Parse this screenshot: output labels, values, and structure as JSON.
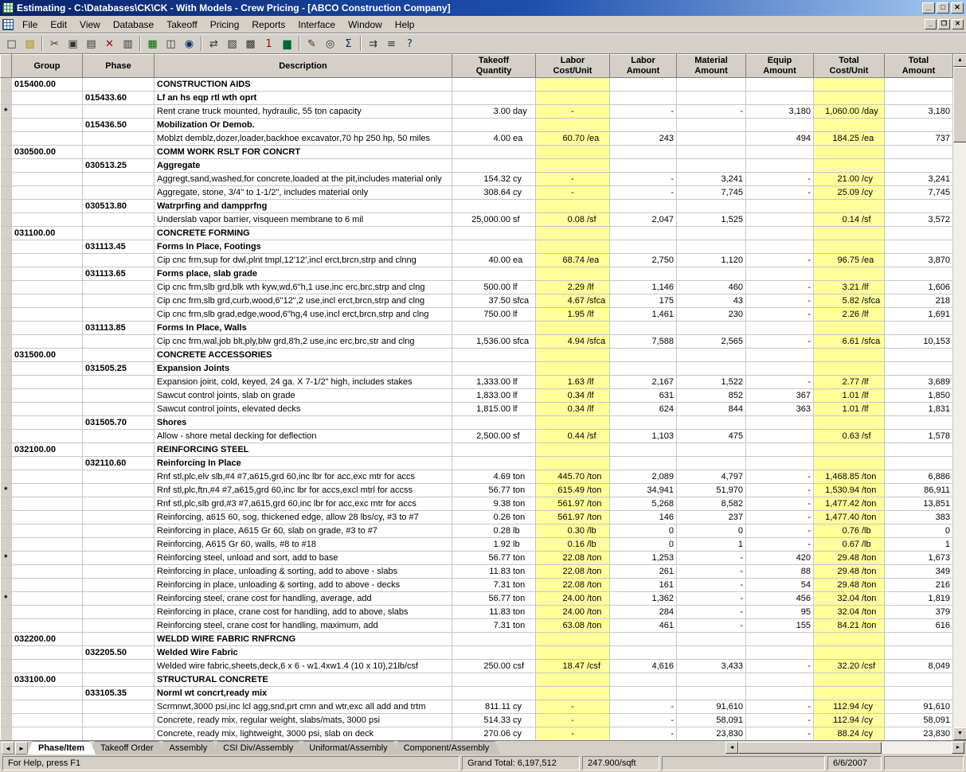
{
  "window": {
    "title": "Estimating - C:\\Databases\\CK\\CK - With Models - Crew Pricing - [ABCO Construction Company]"
  },
  "icons": {
    "minimize": "_",
    "maximize": "□",
    "restore": "❐",
    "close": "✕",
    "up": "▲",
    "down": "▼",
    "left": "◄",
    "right": "►"
  },
  "colors": {
    "titlebar_start": "#0a246a",
    "titlebar_end": "#a6caf0",
    "highlight_column": "#ffff9c",
    "group_text": "#990000",
    "phase_text": "#008080",
    "chrome": "#d4d0c8"
  },
  "menu": [
    "File",
    "Edit",
    "View",
    "Database",
    "Takeoff",
    "Pricing",
    "Reports",
    "Interface",
    "Window",
    "Help"
  ],
  "toolbar": [
    {
      "name": "new-document-icon",
      "glyph": "□"
    },
    {
      "name": "open-folder-icon",
      "glyph": "▨",
      "c": "#b8860b"
    },
    "|",
    {
      "name": "cut-icon",
      "glyph": "✂"
    },
    {
      "name": "copy-icon",
      "glyph": "▣"
    },
    {
      "name": "paste-icon",
      "glyph": "▤"
    },
    {
      "name": "delete-icon",
      "glyph": "✕",
      "c": "#a00000"
    },
    {
      "name": "print-icon",
      "glyph": "▥"
    },
    "|",
    {
      "name": "takeoff-icon",
      "glyph": "▦",
      "c": "#006600"
    },
    {
      "name": "quick-takeoff-icon",
      "glyph": "◫"
    },
    {
      "name": "find-icon",
      "glyph": "◉",
      "c": "#003366"
    },
    "|",
    {
      "name": "rearrange-columns-icon",
      "glyph": "⇄"
    },
    {
      "name": "insert-item-icon",
      "glyph": "▧"
    },
    {
      "name": "detail-window-icon",
      "glyph": "▩"
    },
    {
      "name": "single-item-icon",
      "glyph": "1",
      "c": "#b00000"
    },
    {
      "name": "totals-icon",
      "glyph": "▆",
      "c": "#006633"
    },
    "|",
    {
      "name": "graph-icon",
      "glyph": "✎"
    },
    {
      "name": "zoom-icon",
      "glyph": "◎"
    },
    {
      "name": "sum-icon",
      "glyph": "Σ",
      "c": "#003366"
    },
    "|",
    {
      "name": "goto-icon",
      "glyph": "⇉"
    },
    {
      "name": "crew-pricing-icon",
      "glyph": "≡"
    },
    {
      "name": "help-icon",
      "glyph": "?",
      "c": "#003366"
    }
  ],
  "grid": {
    "columns": [
      {
        "id": "row-marker",
        "label": ""
      },
      {
        "id": "group",
        "label": "Group"
      },
      {
        "id": "phase",
        "label": "Phase"
      },
      {
        "id": "description",
        "label": "Description"
      },
      {
        "id": "takeoff-quantity",
        "label": "Takeoff\nQuantity"
      },
      {
        "id": "labor-cost-unit",
        "label": "Labor\nCost/Unit"
      },
      {
        "id": "labor-amount",
        "label": "Labor\nAmount"
      },
      {
        "id": "material-amount",
        "label": "Material\nAmount"
      },
      {
        "id": "equip-amount",
        "label": "Equip\nAmount"
      },
      {
        "id": "total-cost-unit",
        "label": "Total\nCost/Unit"
      },
      {
        "id": "total-amount",
        "label": "Total\nAmount"
      }
    ],
    "rows": [
      [
        "g",
        "",
        "015400.00",
        "",
        "CONSTRUCTION AIDS",
        "",
        "",
        "",
        "",
        "",
        "",
        ""
      ],
      [
        "p",
        "",
        "",
        "015433.60",
        "Lf an hs eqp rtl wth oprt",
        "",
        "",
        "",
        "",
        "",
        "",
        ""
      ],
      [
        "i",
        "*",
        "",
        "",
        "Rent crane truck mounted, hydraulic, 55 ton capacity",
        "3.00 day",
        "-",
        "-",
        "-",
        "3,180",
        "1,060.00 /day",
        "3,180"
      ],
      [
        "p",
        "",
        "",
        "015436.50",
        "Mobilization Or Demob.",
        "",
        "",
        "",
        "",
        "",
        "",
        ""
      ],
      [
        "i",
        "",
        "",
        "",
        "Moblzt demblz,dozer,loader,backhoe excavator,70 hp 250 hp, 50 miles",
        "4.00 ea",
        "60.70 /ea",
        "243",
        "",
        "494",
        "184.25 /ea",
        "737"
      ],
      [
        "g",
        "",
        "030500.00",
        "",
        "COMM WORK RSLT FOR CONCRT",
        "",
        "",
        "",
        "",
        "",
        "",
        ""
      ],
      [
        "p",
        "",
        "",
        "030513.25",
        "Aggregate",
        "",
        "",
        "",
        "",
        "",
        "",
        ""
      ],
      [
        "i",
        "",
        "",
        "",
        "Aggregt,sand,washed,for concrete,loaded at the pit,includes material only",
        "154.32 cy",
        "-",
        "-",
        "3,241",
        "-",
        "21.00 /cy",
        "3,241"
      ],
      [
        "i",
        "",
        "",
        "",
        "Aggregate, stone, 3/4\" to 1-1/2\", includes material only",
        "308.64 cy",
        "-",
        "-",
        "7,745",
        "-",
        "25.09 /cy",
        "7,745"
      ],
      [
        "p",
        "",
        "",
        "030513.80",
        "Watrprfing and dampprfng",
        "",
        "",
        "",
        "",
        "",
        "",
        ""
      ],
      [
        "i",
        "",
        "",
        "",
        "Underslab vapor barrier, visqueen membrane to 6 mil",
        "25,000.00 sf",
        "0.08 /sf",
        "2,047",
        "1,525",
        "",
        "0.14 /sf",
        "3,572"
      ],
      [
        "g",
        "",
        "031100.00",
        "",
        "CONCRETE FORMING",
        "",
        "",
        "",
        "",
        "",
        "",
        ""
      ],
      [
        "p",
        "",
        "",
        "031113.45",
        "Forms In Place, Footings",
        "",
        "",
        "",
        "",
        "",
        "",
        ""
      ],
      [
        "i",
        "",
        "",
        "",
        "Cip cnc frm,sup for dwl,plnt tmpl,12'12',incl erct,brcn,strp and clnng",
        "40.00 ea",
        "68.74 /ea",
        "2,750",
        "1,120",
        "-",
        "96.75 /ea",
        "3,870"
      ],
      [
        "p",
        "",
        "",
        "031113.65",
        "Forms place, slab grade",
        "",
        "",
        "",
        "",
        "",
        "",
        ""
      ],
      [
        "i",
        "",
        "",
        "",
        "Cip cnc frm,slb grd,blk wth kyw,wd,6\"h,1 use,inc erc,brc,strp and clng",
        "500.00 lf",
        "2.29 /lf",
        "1,146",
        "460",
        "-",
        "3.21 /lf",
        "1,606"
      ],
      [
        "i",
        "",
        "",
        "",
        "Cip cnc frm,slb grd,curb,wood,6\"12\",2 use,incl erct,brcn,strp and clng",
        "37.50 sfca",
        "4.67 /sfca",
        "175",
        "43",
        "-",
        "5.82 /sfca",
        "218"
      ],
      [
        "i",
        "",
        "",
        "",
        "Cip cnc frm,slb grad,edge,wood,6\"hg,4 use,incl erct,brcn,strp and clng",
        "750.00 lf",
        "1.95 /lf",
        "1,461",
        "230",
        "-",
        "2.26 /lf",
        "1,691"
      ],
      [
        "p",
        "",
        "",
        "031113.85",
        "Forms In Place, Walls",
        "",
        "",
        "",
        "",
        "",
        "",
        ""
      ],
      [
        "i",
        "",
        "",
        "",
        "Cip cnc frm,wal,job blt,ply,blw grd,8'h,2 use,inc erc,brc,str and clng",
        "1,536.00 sfca",
        "4.94 /sfca",
        "7,588",
        "2,565",
        "-",
        "6.61 /sfca",
        "10,153"
      ],
      [
        "g",
        "",
        "031500.00",
        "",
        "CONCRETE ACCESSORIES",
        "",
        "",
        "",
        "",
        "",
        "",
        ""
      ],
      [
        "p",
        "",
        "",
        "031505.25",
        "Expansion Joints",
        "",
        "",
        "",
        "",
        "",
        "",
        ""
      ],
      [
        "i",
        "",
        "",
        "",
        "Expansion joint, cold, keyed, 24 ga. X 7-1/2\" high, includes stakes",
        "1,333.00 lf",
        "1.63 /lf",
        "2,167",
        "1,522",
        "-",
        "2.77 /lf",
        "3,689"
      ],
      [
        "i",
        "",
        "",
        "",
        "Sawcut control joints, slab on grade",
        "1,833.00 lf",
        "0.34 /lf",
        "631",
        "852",
        "367",
        "1.01 /lf",
        "1,850"
      ],
      [
        "i",
        "",
        "",
        "",
        "Sawcut control joints, elevated decks",
        "1,815.00 lf",
        "0.34 /lf",
        "624",
        "844",
        "363",
        "1.01 /lf",
        "1,831"
      ],
      [
        "p",
        "",
        "",
        "031505.70",
        "Shores",
        "",
        "",
        "",
        "",
        "",
        "",
        ""
      ],
      [
        "i",
        "",
        "",
        "",
        "Allow - shore metal decking for deflection",
        "2,500.00 sf",
        "0.44 /sf",
        "1,103",
        "475",
        "",
        "0.63 /sf",
        "1,578"
      ],
      [
        "g",
        "",
        "032100.00",
        "",
        "REINFORCING STEEL",
        "",
        "",
        "",
        "",
        "",
        "",
        ""
      ],
      [
        "p",
        "",
        "",
        "032110.60",
        "Reinforcing In Place",
        "",
        "",
        "",
        "",
        "",
        "",
        ""
      ],
      [
        "i",
        "",
        "",
        "",
        "Rnf stl,plc,elv slb,#4 #7,a615,grd 60,inc lbr for acc,exc mtr for accs",
        "4.69 ton",
        "445.70 /ton",
        "2,089",
        "4,797",
        "-",
        "1,468.85 /ton",
        "6,886"
      ],
      [
        "i",
        "*",
        "",
        "",
        "Rnf stl,plc,ftn,#4 #7,a615,grd 60,inc lbr for accs,excl mtrl for accss",
        "56.77 ton",
        "615.49 /ton",
        "34,941",
        "51,970",
        "-",
        "1,530.94 /ton",
        "86,911"
      ],
      [
        "i",
        "",
        "",
        "",
        "Rnf stl,plc,slb grd,#3 #7,a615,grd 60,inc lbr for acc,exc mtr for accs",
        "9.38 ton",
        "561.97 /ton",
        "5,268",
        "8,582",
        "-",
        "1,477.42 /ton",
        "13,851"
      ],
      [
        "i",
        "",
        "",
        "",
        "Reinforcing, a615 60, sog, thickened edge, allow 28 lbs/cy, #3 to #7",
        "0.26 ton",
        "561.97 /ton",
        "146",
        "237",
        "-",
        "1,477.40 /ton",
        "383"
      ],
      [
        "i",
        "",
        "",
        "",
        "Reinforcing in place, A615 Gr 60, slab on grade, #3 to #7",
        "0.28 lb",
        "0.30 /lb",
        "0",
        "0",
        "-",
        "0.76 /lb",
        "0"
      ],
      [
        "i",
        "",
        "",
        "",
        "Reinforcing, A615 Gr 60, walls, #8 to #18",
        "1.92 lb",
        "0.16 /lb",
        "0",
        "1",
        "-",
        "0.67 /lb",
        "1"
      ],
      [
        "i",
        "*",
        "",
        "",
        "Reinforcing steel, unload and sort, add to base",
        "56.77 ton",
        "22.08 /ton",
        "1,253",
        "-",
        "420",
        "29.48 /ton",
        "1,673"
      ],
      [
        "i",
        "",
        "",
        "",
        "Reinforcing in place, unloading & sorting, add to above - slabs",
        "11.83 ton",
        "22.08 /ton",
        "261",
        "-",
        "88",
        "29.48 /ton",
        "349"
      ],
      [
        "i",
        "",
        "",
        "",
        "Reinforcing in place, unloading & sorting, add to above - decks",
        "7.31 ton",
        "22.08 /ton",
        "161",
        "-",
        "54",
        "29.48 /ton",
        "216"
      ],
      [
        "i",
        "*",
        "",
        "",
        "Reinforcing steel, crane cost for handling, average, add",
        "56.77 ton",
        "24.00 /ton",
        "1,362",
        "-",
        "456",
        "32.04 /ton",
        "1,819"
      ],
      [
        "i",
        "",
        "",
        "",
        "Reinforcing in place, crane cost for handling, add to above, slabs",
        "11.83 ton",
        "24.00 /ton",
        "284",
        "-",
        "95",
        "32.04 /ton",
        "379"
      ],
      [
        "i",
        "",
        "",
        "",
        "Reinforcing steel, crane cost for handling, maximum, add",
        "7.31 ton",
        "63.08 /ton",
        "461",
        "-",
        "155",
        "84.21 /ton",
        "616"
      ],
      [
        "g",
        "",
        "032200.00",
        "",
        "WELDD WIRE FABRIC RNFRCNG",
        "",
        "",
        "",
        "",
        "",
        "",
        ""
      ],
      [
        "p",
        "",
        "",
        "032205.50",
        "Welded Wire Fabric",
        "",
        "",
        "",
        "",
        "",
        "",
        ""
      ],
      [
        "i",
        "",
        "",
        "",
        "Welded wire fabric,sheets,deck,6 x 6 - w1.4xw1.4 (10 x 10),21lb/csf",
        "250.00 csf",
        "18.47 /csf",
        "4,616",
        "3,433",
        "-",
        "32.20 /csf",
        "8,049"
      ],
      [
        "g",
        "",
        "033100.00",
        "",
        "STRUCTURAL CONCRETE",
        "",
        "",
        "",
        "",
        "",
        "",
        ""
      ],
      [
        "p",
        "",
        "",
        "033105.35",
        "Norml wt concrt,ready mix",
        "",
        "",
        "",
        "",
        "",
        "",
        ""
      ],
      [
        "i",
        "",
        "",
        "",
        "Scrmnwt,3000 psi,inc lcl agg,snd,prt cmn and wtr,exc all add and trtm",
        "811.11 cy",
        "-",
        "-",
        "91,610",
        "-",
        "112.94 /cy",
        "91,610"
      ],
      [
        "i",
        "",
        "",
        "",
        "Concrete, ready mix, regular weight, slabs/mats, 3000 psi",
        "514.33 cy",
        "-",
        "-",
        "58,091",
        "-",
        "112.94 /cy",
        "58,091"
      ],
      [
        "i",
        "",
        "",
        "",
        "Concrete, ready mix, lightweight, 3000 psi, slab on deck",
        "270.06 cy",
        "-",
        "-",
        "23,830",
        "-",
        "88.24 /cy",
        "23,830"
      ]
    ]
  },
  "tabs": [
    {
      "label": "Phase/Item",
      "active": true
    },
    {
      "label": "Takeoff Order",
      "active": false
    },
    {
      "label": "Assembly",
      "active": false
    },
    {
      "label": "CSI Div/Assembly",
      "active": false
    },
    {
      "label": "Uniformat/Assembly",
      "active": false
    },
    {
      "label": "Component/Assembly",
      "active": false
    }
  ],
  "status": {
    "help_text": "For Help, press F1",
    "grand_total": "Grand Total: 6,197,512",
    "per_sqft": "247.900/sqft",
    "date": "6/6/2007"
  }
}
